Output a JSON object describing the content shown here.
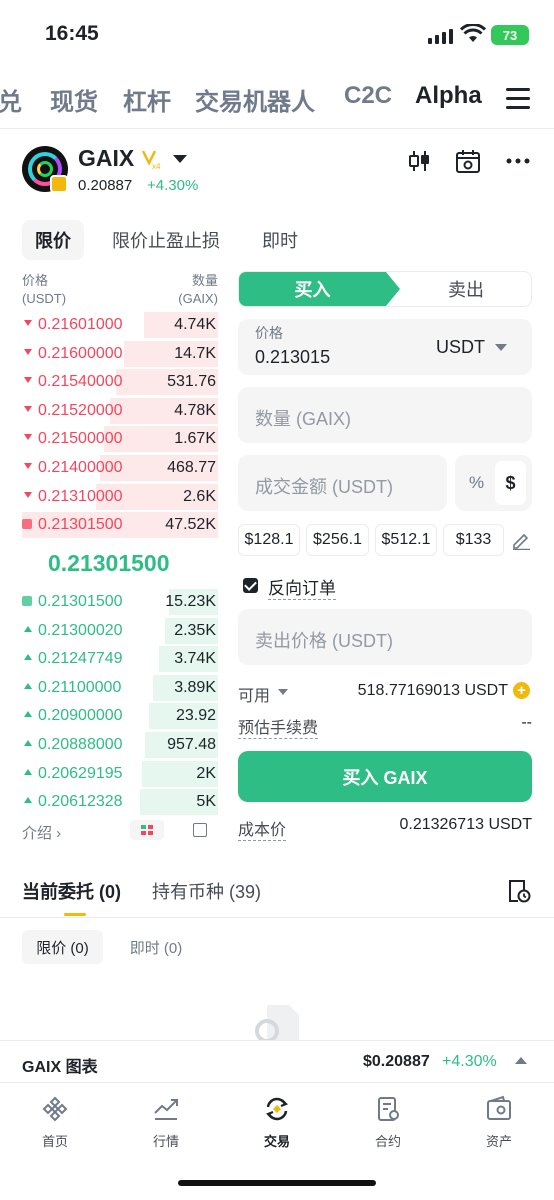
{
  "status": {
    "time": "16:45",
    "battery": "73"
  },
  "top_tabs": [
    "兑",
    "现货",
    "杠杆",
    "交易机器人",
    "C2C",
    "Alpha"
  ],
  "header": {
    "pair": "GAIX",
    "price": "0.20887",
    "change": "+4.30%",
    "vbadge": "x4"
  },
  "order_type_tabs": [
    "限价",
    "限价止盈止损",
    "即时"
  ],
  "orderbook": {
    "price_header": "价格",
    "price_unit": "(USDT)",
    "qty_header": "数量",
    "qty_unit": "(GAIX)",
    "asks": [
      {
        "price": "0.21601000",
        "qty": "4.74K",
        "depth": 0.38
      },
      {
        "price": "0.21600000",
        "qty": "14.7K",
        "depth": 0.48
      },
      {
        "price": "0.21540000",
        "qty": "531.76",
        "depth": 0.52
      },
      {
        "price": "0.21520000",
        "qty": "4.78K",
        "depth": 0.55
      },
      {
        "price": "0.21500000",
        "qty": "1.67K",
        "depth": 0.58
      },
      {
        "price": "0.21400000",
        "qty": "468.77",
        "depth": 0.6
      },
      {
        "price": "0.21310000",
        "qty": "2.6K",
        "depth": 0.62
      },
      {
        "price": "0.21301500",
        "qty": "47.52K",
        "depth": 1.0
      }
    ],
    "mid_price": "0.21301500",
    "bids": [
      {
        "price": "0.21301500",
        "qty": "15.23K",
        "depth": 0.25
      },
      {
        "price": "0.21300020",
        "qty": "2.35K",
        "depth": 0.27
      },
      {
        "price": "0.21247749",
        "qty": "3.74K",
        "depth": 0.3
      },
      {
        "price": "0.21100000",
        "qty": "3.89K",
        "depth": 0.33
      },
      {
        "price": "0.20900000",
        "qty": "23.92",
        "depth": 0.35
      },
      {
        "price": "0.20888000",
        "qty": "957.48",
        "depth": 0.37
      },
      {
        "price": "0.20629195",
        "qty": "2K",
        "depth": 0.39
      },
      {
        "price": "0.20612328",
        "qty": "5K",
        "depth": 0.4
      }
    ],
    "intro": "介绍 ›"
  },
  "form": {
    "buy_label": "买入",
    "sell_label": "卖出",
    "price_label": "价格",
    "price_value": "0.213015",
    "price_unit": "USDT",
    "qty_placeholder": "数量 (GAIX)",
    "total_placeholder": "成交金额 (USDT)",
    "pct_symbol": "%",
    "usd_symbol": "$",
    "chips": [
      "$128.1",
      "$256.1",
      "$512.1",
      "$133"
    ],
    "reverse_label": "反向订单",
    "sell_price_placeholder": "卖出价格 (USDT)",
    "available_label": "可用",
    "available_value": "518.77169013 USDT",
    "fee_label": "预估手续费",
    "fee_value": "--",
    "buy_button": "买入 GAIX",
    "cost_label": "成本价",
    "cost_value": "0.21326713 USDT"
  },
  "orders": {
    "tab_open": "当前委托 (0)",
    "tab_holdings": "持有币种 (39)",
    "sub_limit": "限价 (0)",
    "sub_instant": "即时 (0)"
  },
  "chart_bar": {
    "title": "GAIX 图表",
    "price": "$0.20887",
    "change": "+4.30%"
  },
  "nav": [
    "首页",
    "行情",
    "交易",
    "合约",
    "资产"
  ],
  "colors": {
    "green": "#2ebd85",
    "red": "#f6465d",
    "yellow": "#f0b90b"
  }
}
